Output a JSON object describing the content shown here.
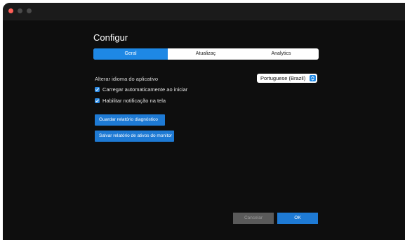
{
  "window": {
    "title": "Configur"
  },
  "tabs": [
    {
      "label": "Geral",
      "active": true
    },
    {
      "label": "Atualizaç",
      "active": false
    },
    {
      "label": "Analytics",
      "active": false
    }
  ],
  "language": {
    "label": "Alterar idioma do aplicativo",
    "selected": "Portuguese (Brazil)"
  },
  "options": [
    {
      "label": "Carregar automaticamente ao iniciar",
      "checked": true
    },
    {
      "label": "Habilitar notificação na tela",
      "checked": true
    }
  ],
  "actions": {
    "diagnostic": "Guardar relatório diagnóstico",
    "assets": "Salvar relatório de ativos do monitor"
  },
  "footer": {
    "cancel": "Cancelar",
    "ok": "OK"
  },
  "colors": {
    "accent": "#1e7ad4",
    "background": "#0e0e0e",
    "close": "#ff5f57"
  }
}
